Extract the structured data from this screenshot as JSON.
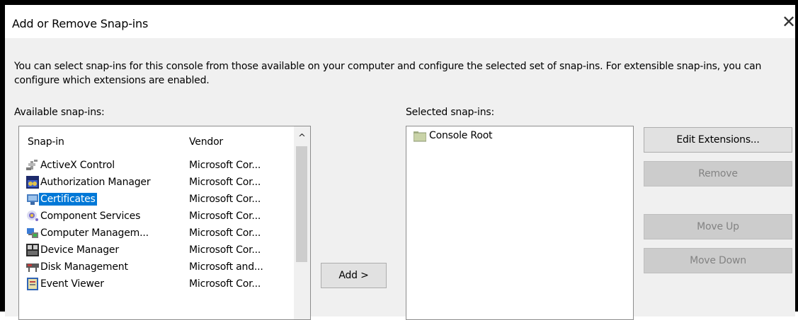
{
  "window": {
    "title": "Add or Remove Snap-ins",
    "close_glyph": "✕"
  },
  "description": "You can select snap-ins for this console from those available on your computer and configure the selected set of snap-ins. For extensible snap-ins, you can configure which extensions are enabled.",
  "available": {
    "label": "Available snap-ins:",
    "columns": {
      "snapin": "Snap-in",
      "vendor": "Vendor"
    },
    "scroll_up_glyph": "^",
    "items": [
      {
        "name": "ActiveX Control",
        "vendor": "Microsoft Cor...",
        "icon": "activex-icon"
      },
      {
        "name": "Authorization Manager",
        "vendor": "Microsoft Cor...",
        "icon": "authorization-manager-icon"
      },
      {
        "name": "Certificates",
        "vendor": "Microsoft Cor...",
        "icon": "certificates-icon",
        "selected": true
      },
      {
        "name": "Component Services",
        "vendor": "Microsoft Cor...",
        "icon": "component-services-icon"
      },
      {
        "name": "Computer Managem...",
        "vendor": "Microsoft Cor...",
        "icon": "computer-management-icon"
      },
      {
        "name": "Device Manager",
        "vendor": "Microsoft Cor...",
        "icon": "device-manager-icon"
      },
      {
        "name": "Disk Management",
        "vendor": "Microsoft and...",
        "icon": "disk-management-icon"
      },
      {
        "name": "Event Viewer",
        "vendor": "Microsoft Cor...",
        "icon": "event-viewer-icon"
      }
    ]
  },
  "add_button": "Add >",
  "selected": {
    "label": "Selected snap-ins:",
    "items": [
      {
        "name": "Console Root",
        "icon": "folder-icon"
      }
    ]
  },
  "buttons": {
    "edit_extensions": "Edit Extensions...",
    "remove": "Remove",
    "move_up": "Move Up",
    "move_down": "Move Down"
  },
  "colors": {
    "selection": "#0078d7",
    "dialog_background": "#f0f0f0",
    "disabled_text": "#838383"
  }
}
